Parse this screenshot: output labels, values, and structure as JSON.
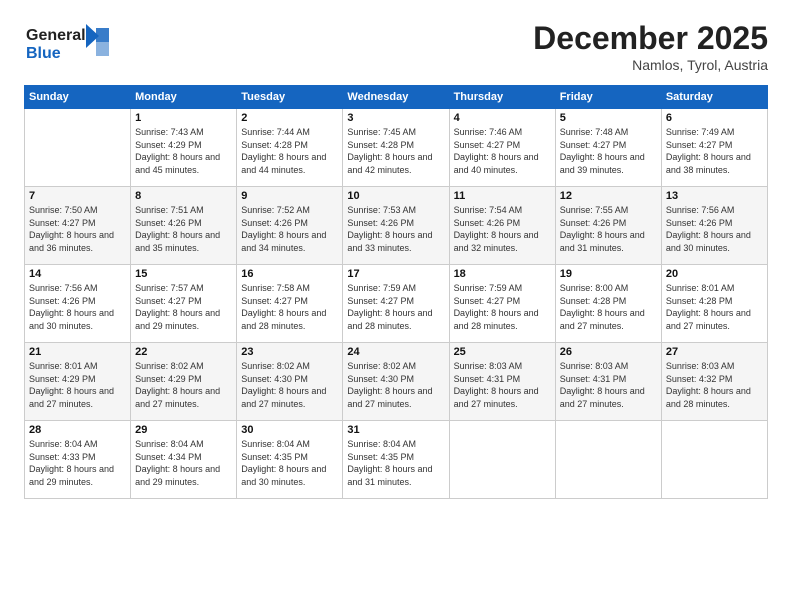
{
  "logo": {
    "line1": "General",
    "line2": "Blue"
  },
  "title": "December 2025",
  "location": "Namlos, Tyrol, Austria",
  "days_of_week": [
    "Sunday",
    "Monday",
    "Tuesday",
    "Wednesday",
    "Thursday",
    "Friday",
    "Saturday"
  ],
  "weeks": [
    [
      {
        "day": "",
        "sunrise": "",
        "sunset": "",
        "daylight": ""
      },
      {
        "day": "1",
        "sunrise": "Sunrise: 7:43 AM",
        "sunset": "Sunset: 4:29 PM",
        "daylight": "Daylight: 8 hours and 45 minutes."
      },
      {
        "day": "2",
        "sunrise": "Sunrise: 7:44 AM",
        "sunset": "Sunset: 4:28 PM",
        "daylight": "Daylight: 8 hours and 44 minutes."
      },
      {
        "day": "3",
        "sunrise": "Sunrise: 7:45 AM",
        "sunset": "Sunset: 4:28 PM",
        "daylight": "Daylight: 8 hours and 42 minutes."
      },
      {
        "day": "4",
        "sunrise": "Sunrise: 7:46 AM",
        "sunset": "Sunset: 4:27 PM",
        "daylight": "Daylight: 8 hours and 40 minutes."
      },
      {
        "day": "5",
        "sunrise": "Sunrise: 7:48 AM",
        "sunset": "Sunset: 4:27 PM",
        "daylight": "Daylight: 8 hours and 39 minutes."
      },
      {
        "day": "6",
        "sunrise": "Sunrise: 7:49 AM",
        "sunset": "Sunset: 4:27 PM",
        "daylight": "Daylight: 8 hours and 38 minutes."
      }
    ],
    [
      {
        "day": "7",
        "sunrise": "Sunrise: 7:50 AM",
        "sunset": "Sunset: 4:27 PM",
        "daylight": "Daylight: 8 hours and 36 minutes."
      },
      {
        "day": "8",
        "sunrise": "Sunrise: 7:51 AM",
        "sunset": "Sunset: 4:26 PM",
        "daylight": "Daylight: 8 hours and 35 minutes."
      },
      {
        "day": "9",
        "sunrise": "Sunrise: 7:52 AM",
        "sunset": "Sunset: 4:26 PM",
        "daylight": "Daylight: 8 hours and 34 minutes."
      },
      {
        "day": "10",
        "sunrise": "Sunrise: 7:53 AM",
        "sunset": "Sunset: 4:26 PM",
        "daylight": "Daylight: 8 hours and 33 minutes."
      },
      {
        "day": "11",
        "sunrise": "Sunrise: 7:54 AM",
        "sunset": "Sunset: 4:26 PM",
        "daylight": "Daylight: 8 hours and 32 minutes."
      },
      {
        "day": "12",
        "sunrise": "Sunrise: 7:55 AM",
        "sunset": "Sunset: 4:26 PM",
        "daylight": "Daylight: 8 hours and 31 minutes."
      },
      {
        "day": "13",
        "sunrise": "Sunrise: 7:56 AM",
        "sunset": "Sunset: 4:26 PM",
        "daylight": "Daylight: 8 hours and 30 minutes."
      }
    ],
    [
      {
        "day": "14",
        "sunrise": "Sunrise: 7:56 AM",
        "sunset": "Sunset: 4:26 PM",
        "daylight": "Daylight: 8 hours and 30 minutes."
      },
      {
        "day": "15",
        "sunrise": "Sunrise: 7:57 AM",
        "sunset": "Sunset: 4:27 PM",
        "daylight": "Daylight: 8 hours and 29 minutes."
      },
      {
        "day": "16",
        "sunrise": "Sunrise: 7:58 AM",
        "sunset": "Sunset: 4:27 PM",
        "daylight": "Daylight: 8 hours and 28 minutes."
      },
      {
        "day": "17",
        "sunrise": "Sunrise: 7:59 AM",
        "sunset": "Sunset: 4:27 PM",
        "daylight": "Daylight: 8 hours and 28 minutes."
      },
      {
        "day": "18",
        "sunrise": "Sunrise: 7:59 AM",
        "sunset": "Sunset: 4:27 PM",
        "daylight": "Daylight: 8 hours and 28 minutes."
      },
      {
        "day": "19",
        "sunrise": "Sunrise: 8:00 AM",
        "sunset": "Sunset: 4:28 PM",
        "daylight": "Daylight: 8 hours and 27 minutes."
      },
      {
        "day": "20",
        "sunrise": "Sunrise: 8:01 AM",
        "sunset": "Sunset: 4:28 PM",
        "daylight": "Daylight: 8 hours and 27 minutes."
      }
    ],
    [
      {
        "day": "21",
        "sunrise": "Sunrise: 8:01 AM",
        "sunset": "Sunset: 4:29 PM",
        "daylight": "Daylight: 8 hours and 27 minutes."
      },
      {
        "day": "22",
        "sunrise": "Sunrise: 8:02 AM",
        "sunset": "Sunset: 4:29 PM",
        "daylight": "Daylight: 8 hours and 27 minutes."
      },
      {
        "day": "23",
        "sunrise": "Sunrise: 8:02 AM",
        "sunset": "Sunset: 4:30 PM",
        "daylight": "Daylight: 8 hours and 27 minutes."
      },
      {
        "day": "24",
        "sunrise": "Sunrise: 8:02 AM",
        "sunset": "Sunset: 4:30 PM",
        "daylight": "Daylight: 8 hours and 27 minutes."
      },
      {
        "day": "25",
        "sunrise": "Sunrise: 8:03 AM",
        "sunset": "Sunset: 4:31 PM",
        "daylight": "Daylight: 8 hours and 27 minutes."
      },
      {
        "day": "26",
        "sunrise": "Sunrise: 8:03 AM",
        "sunset": "Sunset: 4:31 PM",
        "daylight": "Daylight: 8 hours and 27 minutes."
      },
      {
        "day": "27",
        "sunrise": "Sunrise: 8:03 AM",
        "sunset": "Sunset: 4:32 PM",
        "daylight": "Daylight: 8 hours and 28 minutes."
      }
    ],
    [
      {
        "day": "28",
        "sunrise": "Sunrise: 8:04 AM",
        "sunset": "Sunset: 4:33 PM",
        "daylight": "Daylight: 8 hours and 29 minutes."
      },
      {
        "day": "29",
        "sunrise": "Sunrise: 8:04 AM",
        "sunset": "Sunset: 4:34 PM",
        "daylight": "Daylight: 8 hours and 29 minutes."
      },
      {
        "day": "30",
        "sunrise": "Sunrise: 8:04 AM",
        "sunset": "Sunset: 4:35 PM",
        "daylight": "Daylight: 8 hours and 30 minutes."
      },
      {
        "day": "31",
        "sunrise": "Sunrise: 8:04 AM",
        "sunset": "Sunset: 4:35 PM",
        "daylight": "Daylight: 8 hours and 31 minutes."
      },
      {
        "day": "",
        "sunrise": "",
        "sunset": "",
        "daylight": ""
      },
      {
        "day": "",
        "sunrise": "",
        "sunset": "",
        "daylight": ""
      },
      {
        "day": "",
        "sunrise": "",
        "sunset": "",
        "daylight": ""
      }
    ]
  ]
}
